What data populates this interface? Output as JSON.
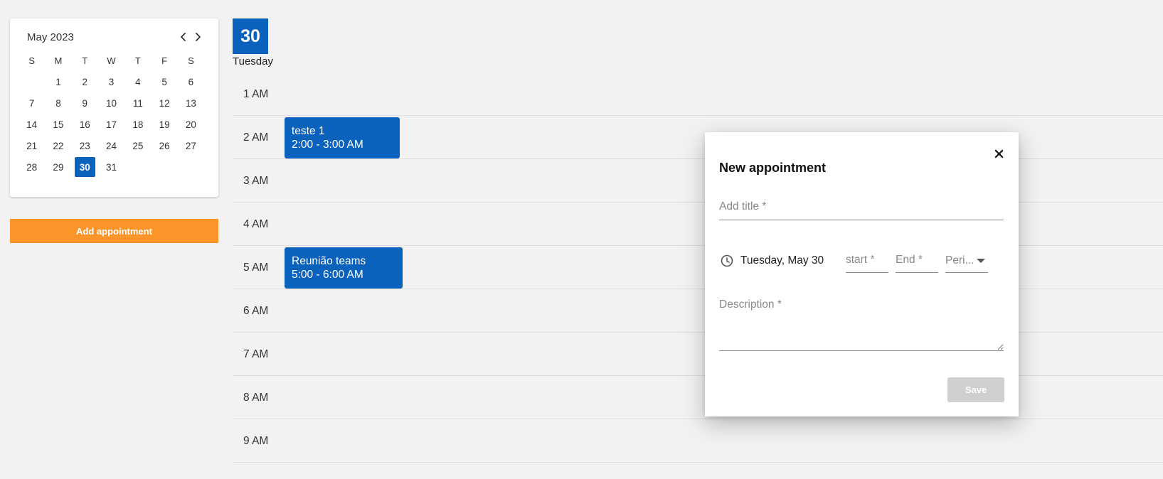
{
  "mini_calendar": {
    "month_label": "May 2023",
    "weekdays": [
      "S",
      "M",
      "T",
      "W",
      "T",
      "F",
      "S"
    ],
    "weeks": [
      [
        "",
        "1",
        "2",
        "3",
        "4",
        "5",
        "6"
      ],
      [
        "7",
        "8",
        "9",
        "10",
        "11",
        "12",
        "13"
      ],
      [
        "14",
        "15",
        "16",
        "17",
        "18",
        "19",
        "20"
      ],
      [
        "21",
        "22",
        "23",
        "24",
        "25",
        "26",
        "27"
      ],
      [
        "28",
        "29",
        "30",
        "31",
        "",
        "",
        ""
      ]
    ],
    "selected_day": "30"
  },
  "sidebar": {
    "add_button_label": "Add appointment"
  },
  "day_view": {
    "day_number": "30",
    "day_name": "Tuesday",
    "hours": [
      "1 AM",
      "2 AM",
      "3 AM",
      "4 AM",
      "5 AM",
      "6 AM",
      "7 AM",
      "8 AM",
      "9 AM"
    ],
    "appointments": [
      {
        "title": "teste 1",
        "time": "2:00 - 3:00 AM"
      },
      {
        "title": "Reunião teams",
        "time": "5:00 - 6:00 AM"
      }
    ]
  },
  "dialog": {
    "title": "New appointment",
    "title_placeholder": "Add title *",
    "date_text": "Tuesday, May 30",
    "start_placeholder": "start *",
    "end_placeholder": "End *",
    "period_placeholder": "Peri...",
    "description_placeholder": "Description *",
    "save_label": "Save"
  },
  "colors": {
    "accent": "#0a62bd",
    "add_button": "#fb9429",
    "save_disabled": "#cfcfcf"
  },
  "icons": {
    "prev": "chevron-left-icon",
    "next": "chevron-right-icon",
    "close": "close-icon",
    "time": "clock-icon",
    "dropdown": "caret-down-icon"
  }
}
